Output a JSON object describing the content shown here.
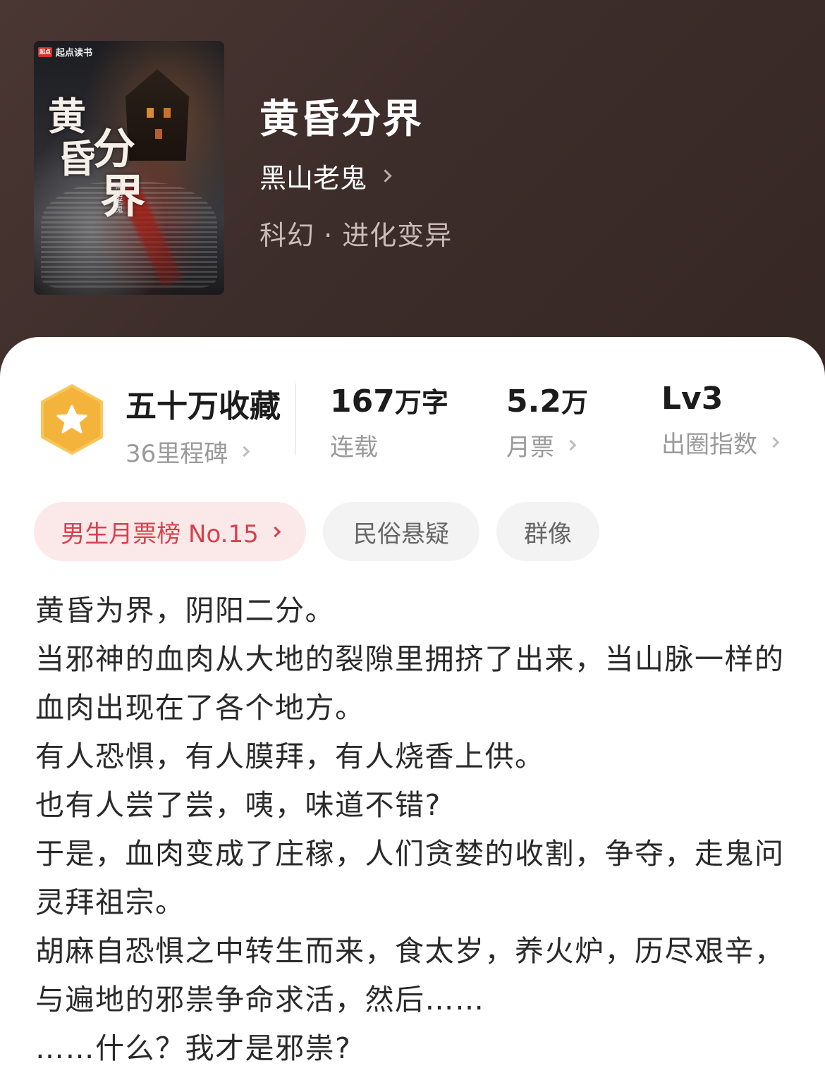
{
  "cover": {
    "brand": "起点读书",
    "brand_logo": "起点",
    "title_chars": [
      "黄",
      "昏",
      "分",
      "界"
    ],
    "author": "黑山老鬼"
  },
  "book": {
    "title": "黄昏分界",
    "author": "黑山老鬼",
    "category": "科幻 · 进化变异"
  },
  "stats": {
    "collections": {
      "value": "五十万收藏",
      "label": "36里程碑"
    },
    "words": {
      "value": "167",
      "unit": "万字",
      "label": "连载"
    },
    "monthly_tickets": {
      "value": "5.2",
      "unit": "万",
      "label": "月票"
    },
    "popularity": {
      "value": "Lv3",
      "label": "出圈指数"
    }
  },
  "tags": {
    "rank": "男生月票榜 No.15",
    "tag1": "民俗悬疑",
    "tag2": "群像"
  },
  "synopsis": [
    "黄昏为界，阴阳二分。",
    "当邪神的血肉从大地的裂隙里拥挤了出来，当山脉一样的血肉出现在了各个地方。",
    "有人恐惧，有人膜拜，有人烧香上供。",
    "也有人尝了尝，咦，味道不错?",
    "于是，血肉变成了庄稼，人们贪婪的收割，争夺，走鬼问灵拜祖宗。",
    "胡麻自恐惧之中转生而来，食太岁，养火炉，历尽艰辛，与遍地的邪祟争命求活，然后……",
    "……什么？我才是邪祟?"
  ],
  "colors": {
    "header_bg": "#3d2d2a",
    "badge": "#f4b43c",
    "rank_tag_text": "#d8404a",
    "rank_tag_bg": "#fbe9ea"
  }
}
